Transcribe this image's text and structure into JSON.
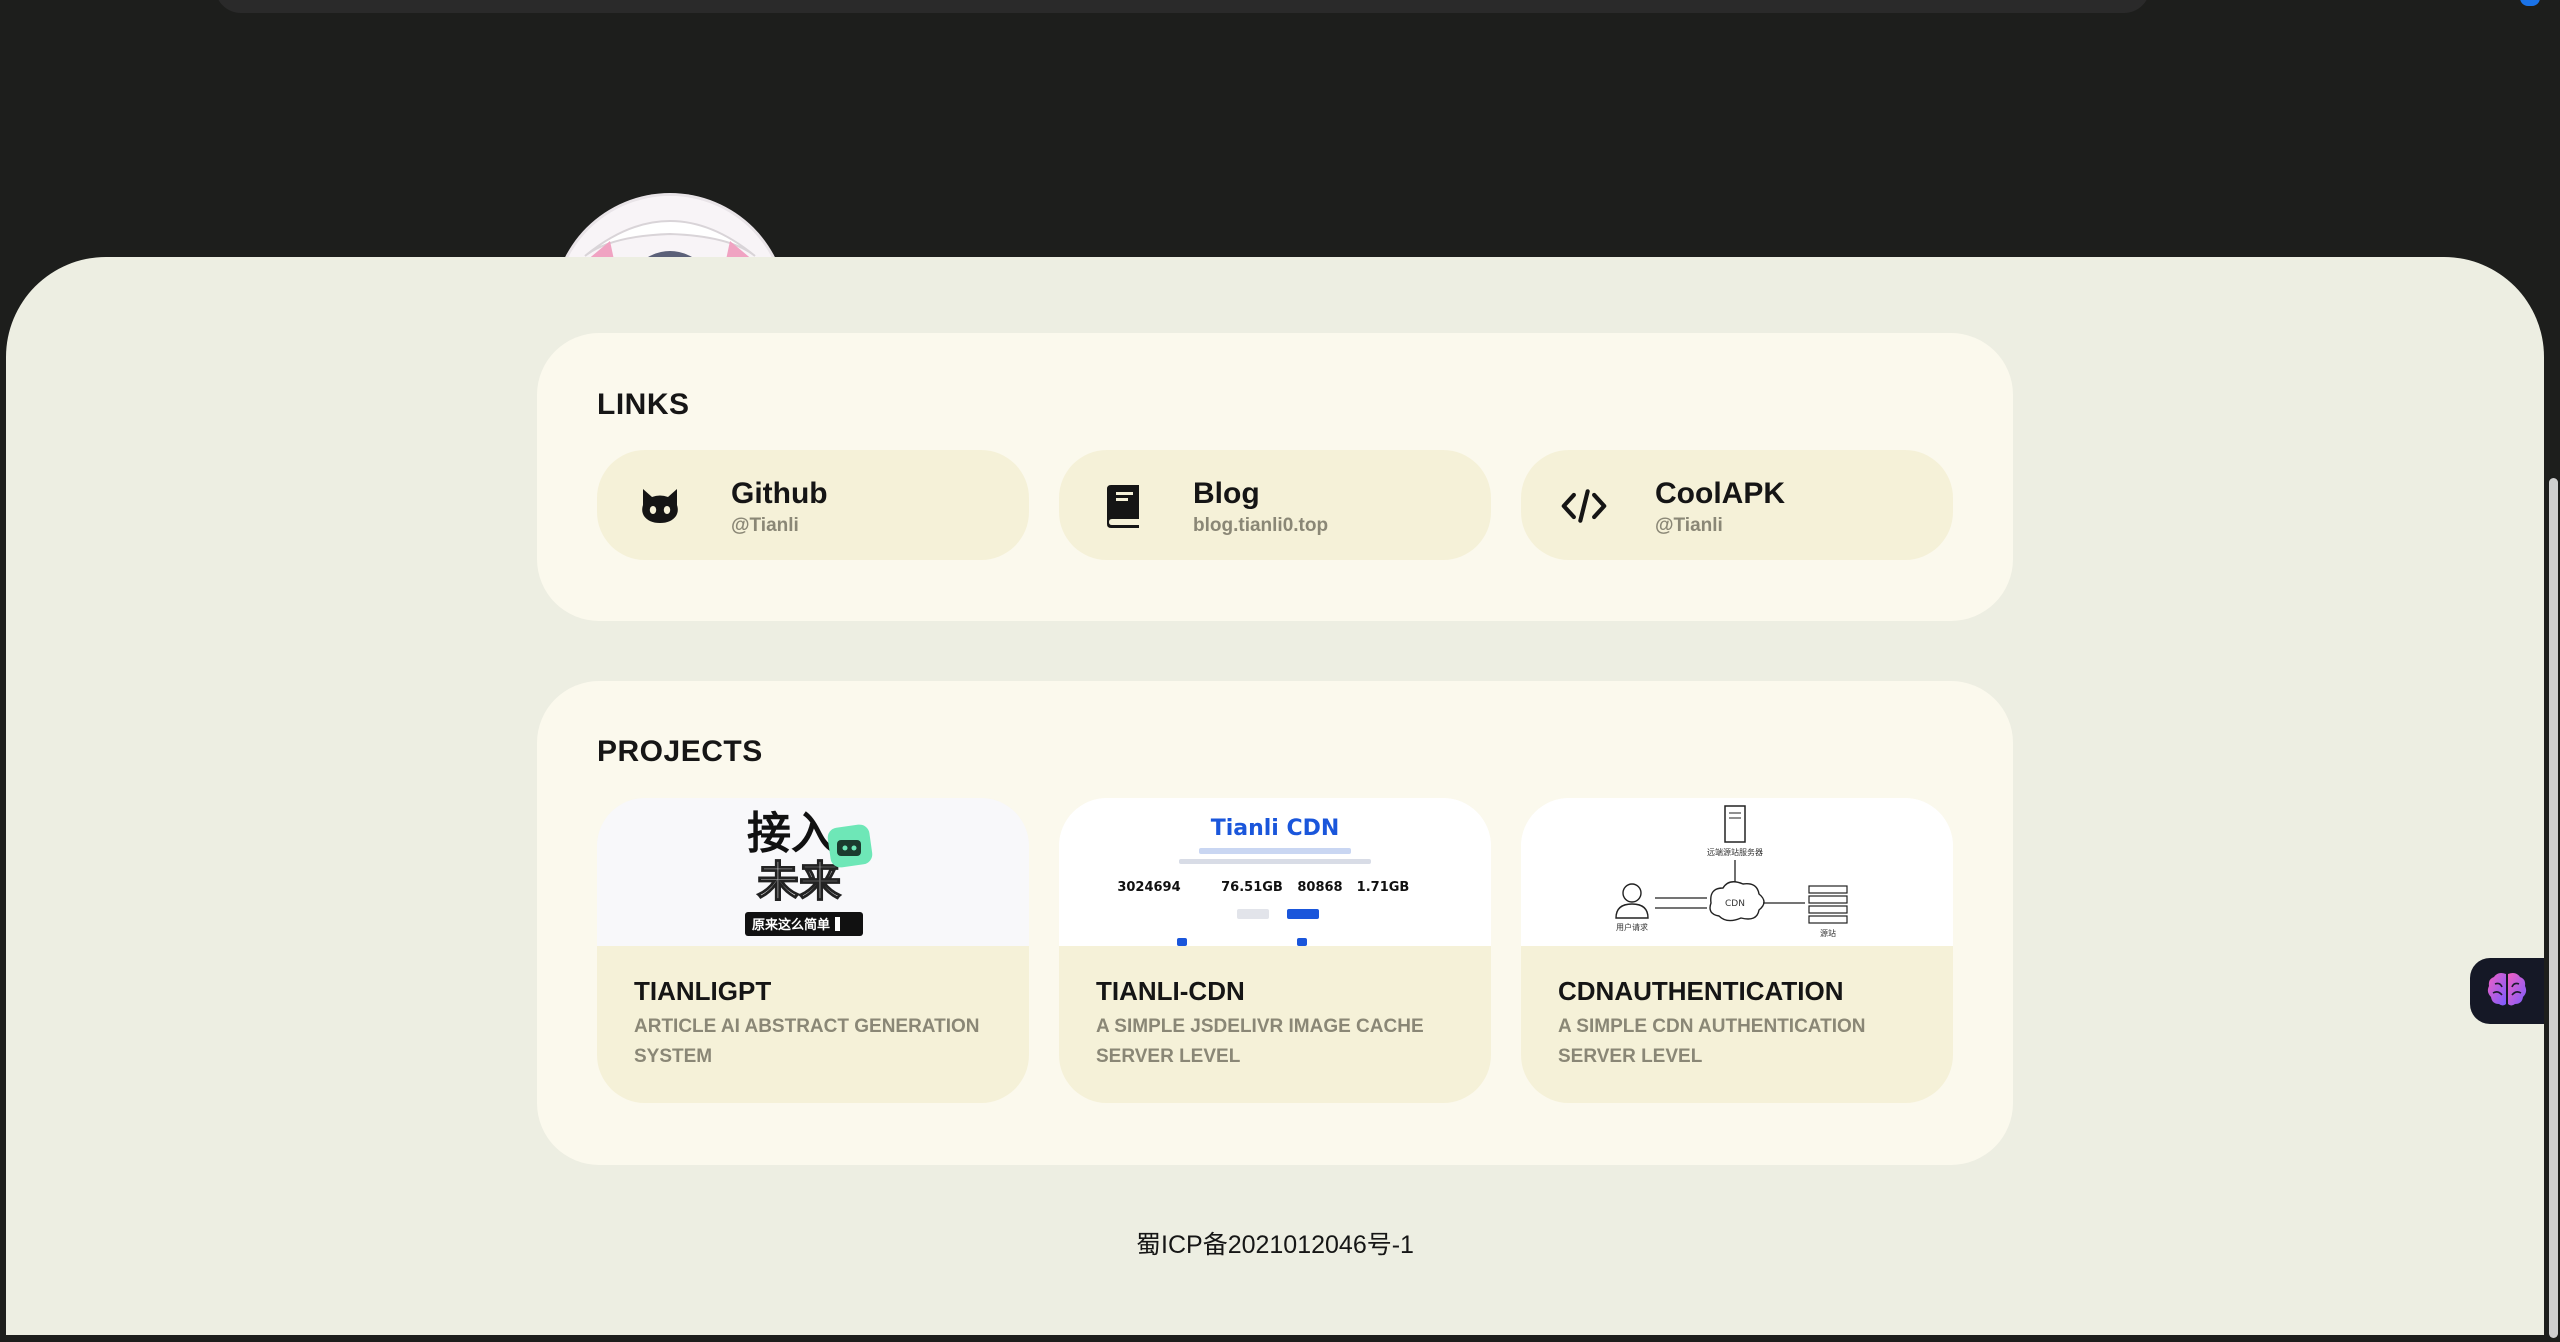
{
  "links": {
    "title": "LINKS",
    "items": [
      {
        "name": "Github",
        "sub": "@Tianli",
        "icon": "github-icon"
      },
      {
        "name": "Blog",
        "sub": "blog.tianli0.top",
        "icon": "book-icon"
      },
      {
        "name": "CoolAPK",
        "sub": "@Tianli",
        "icon": "code-icon"
      }
    ]
  },
  "projects": {
    "title": "PROJECTS",
    "items": [
      {
        "title": "TIANLIGPT",
        "desc": "ARTICLE AI ABSTRACT GENERATION SYSTEM"
      },
      {
        "title": "TIANLI-CDN",
        "desc": "A SIMPLE JSDELIVR IMAGE CACHE SERVER LEVEL"
      },
      {
        "title": "CDNAUTHENTICATION",
        "desc": "A SIMPLE CDN AUTHENTICATION SERVER LEVEL"
      }
    ]
  },
  "thumbs": {
    "gpt": {
      "line1": "接入",
      "line2": "未来",
      "caption": "原来这么简单"
    },
    "cdn": {
      "heading": "Tianli CDN",
      "stats": [
        "3024694",
        "76.51GB",
        "80868",
        "1.71GB"
      ]
    },
    "auth": {
      "top_label": "远端源站服务器",
      "left_label": "用户请求",
      "center_label": "CDN",
      "right_label": "源站"
    }
  },
  "footer": {
    "icp": "蜀ICP备2021012046号-1"
  },
  "colors": {
    "page_bg": "#1d1e1c",
    "sheet_bg": "#edeee2",
    "card_bg": "#fbf9ed",
    "item_bg": "#f5f1d8",
    "muted_text": "#8a8776",
    "cdn_blue": "#1a56db"
  },
  "icons": [
    "brain-icon",
    "github-icon",
    "book-icon",
    "code-icon"
  ]
}
